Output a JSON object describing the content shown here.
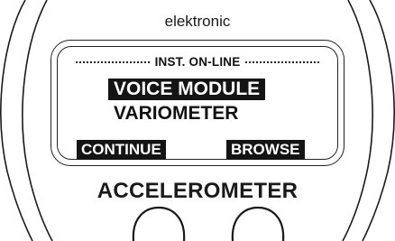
{
  "device": {
    "brand": "elektronic",
    "model_label": "ACCELEROMETER"
  },
  "screen": {
    "header": "INST. ON-LINE",
    "menu_items": [
      {
        "label": "VOICE MODULE",
        "selected": true
      },
      {
        "label": "VARIOMETER",
        "selected": false
      }
    ],
    "softkeys": {
      "left": "CONTINUE",
      "right": "BROWSE"
    }
  },
  "colors": {
    "ink": "#141414",
    "background": "#ffffff"
  },
  "icons": [
    "left-knob-icon",
    "right-knob-icon"
  ]
}
